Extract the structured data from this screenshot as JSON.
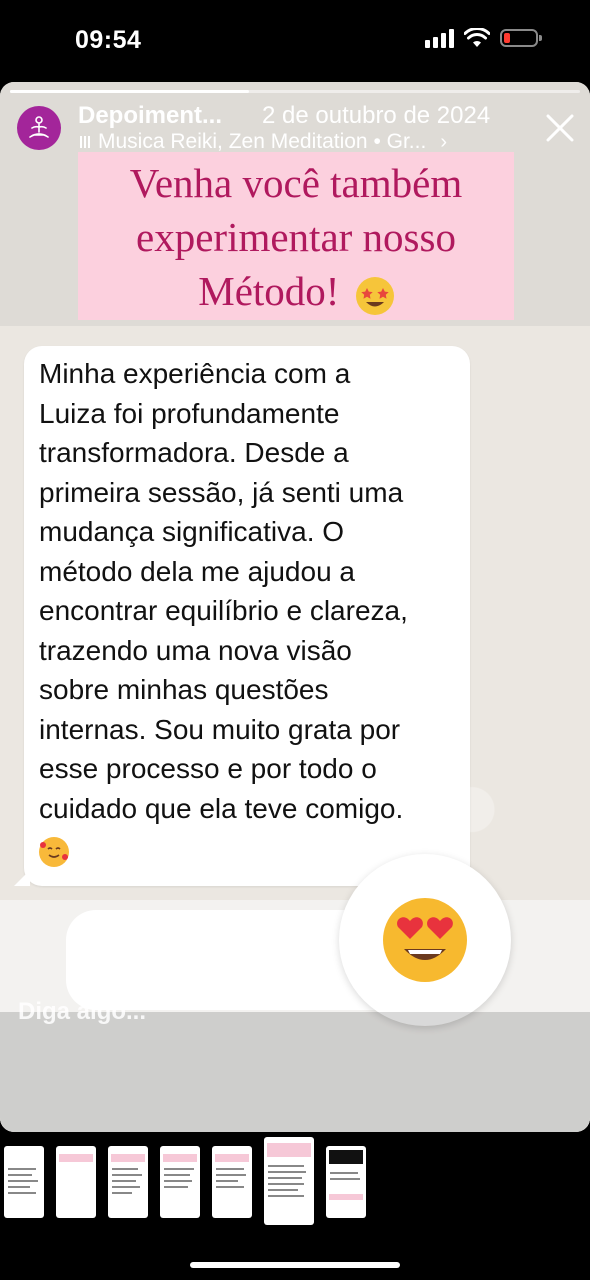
{
  "status_bar": {
    "time": "09:54"
  },
  "story": {
    "account_name": "Depoiment...",
    "date": "2 de outubro de 2024",
    "music": "Musica Reiki, Zen Meditation • Gr...",
    "headline_lines": [
      "Venha você também",
      "experimentar nosso",
      "Método!"
    ],
    "testimonial_lines": [
      "Minha experiência com a",
      "Luiza foi profundamente",
      "transformadora. Desde a",
      "primeira sessão, já senti uma",
      "mudança significativa. O",
      "método dela me ajudou a",
      "encontrar equilíbrio e clareza,",
      "trazendo uma nova visão",
      "sobre minhas questões",
      "internas. Sou muito grata por",
      "esse processo e por todo o",
      "cuidado que ela teve comigo."
    ],
    "reply_placeholder": "Diga algo...",
    "icons": {
      "avatar": "meditation-icon",
      "close": "close-icon",
      "star_eyes": "star-struck-emoji",
      "smiling_hearts": "smiling-face-with-hearts-emoji",
      "heart_eyes": "heart-eyes-emoji"
    }
  },
  "thumbnails": {
    "count": 7,
    "active_index": 5
  },
  "colors": {
    "headline_bg": "#fcd0de",
    "headline_text": "#b0195e",
    "avatar_bg": "#a3259a"
  }
}
